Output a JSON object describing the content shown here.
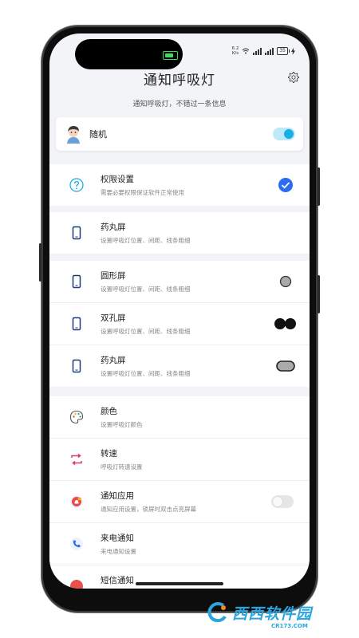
{
  "status_bar": {
    "net_speed_value": "6.2",
    "net_speed_unit": "K/s",
    "battery": "35"
  },
  "header": {
    "title": "通知呼吸灯",
    "subtitle": "通知呼吸灯，不错过一条信息"
  },
  "random": {
    "label": "随机",
    "enabled": true
  },
  "permission_group": [
    {
      "label": "权限设置",
      "desc": "需要必要权限保证软件正常使用",
      "icon": "question-icon",
      "checked": true
    }
  ],
  "screen_group": [
    {
      "label": "药丸屏",
      "desc": "设置呼吸灯位置、间距、线条粗细",
      "icon": "phone-icon",
      "marker": "none"
    }
  ],
  "shape_group": [
    {
      "label": "圆形屏",
      "desc": "设置呼吸灯位置、间距、线条粗细",
      "icon": "phone-icon",
      "marker": "circle"
    },
    {
      "label": "双孔屏",
      "desc": "设置呼吸灯位置、间距、线条粗细",
      "icon": "phone-icon",
      "marker": "double-circle"
    },
    {
      "label": "药丸屏",
      "desc": "设置呼吸灯位置、间距、线条粗细",
      "icon": "phone-icon",
      "marker": "pill"
    }
  ],
  "settings_group": [
    {
      "label": "颜色",
      "desc": "设置呼吸灯颜色",
      "icon": "palette-icon"
    },
    {
      "label": "转速",
      "desc": "呼吸灯转速设置",
      "icon": "rotate-icon"
    },
    {
      "label": "通知应用",
      "desc": "通知应用设置，锁屏时双击点亮屏幕",
      "icon": "app-notify-icon",
      "toggle": false
    },
    {
      "label": "来电通知",
      "desc": "来电通知设置",
      "icon": "phone-call-icon"
    },
    {
      "label": "短信通知",
      "desc": "",
      "icon": "sms-icon"
    }
  ],
  "watermark": {
    "brand": "西西软件园",
    "url": "CR173.COM"
  },
  "colors": {
    "accent": "#1aaee8",
    "check": "#2a6df4",
    "background": "#f3f4f8"
  }
}
